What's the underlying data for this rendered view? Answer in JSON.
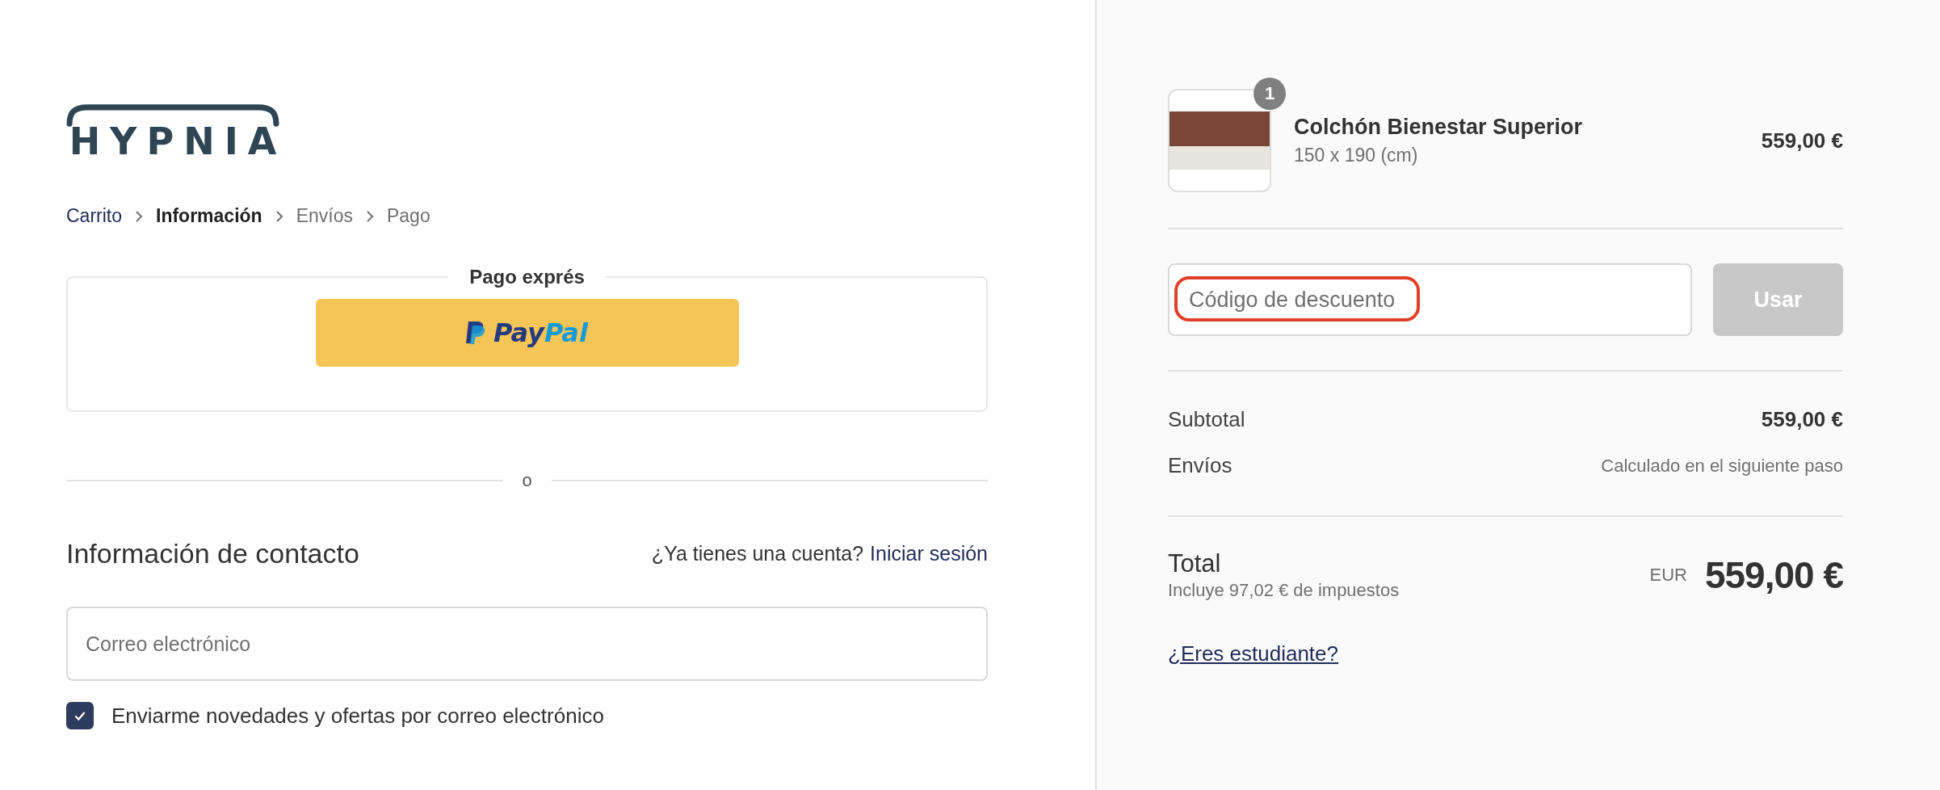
{
  "logo": {
    "text": "HYPNIA"
  },
  "breadcrumb": [
    {
      "label": "Carrito",
      "kind": "link"
    },
    {
      "label": "Información",
      "kind": "current"
    },
    {
      "label": "Envíos",
      "kind": "upcoming"
    },
    {
      "label": "Pago",
      "kind": "upcoming"
    }
  ],
  "express_checkout": {
    "title": "Pago exprés",
    "paypal_button": {
      "text_dark": "Pay",
      "text_light": "Pal"
    }
  },
  "separator": "o",
  "contact": {
    "title": "Información de contacto",
    "account_prompt": "¿Ya tienes una cuenta?",
    "login_link": "Iniciar sesión",
    "email_field": {
      "placeholder": "Correo electrónico"
    },
    "newsletter": {
      "label": "Enviarme novedades y ofertas por correo electrónico",
      "checked": true
    }
  },
  "order_summary": {
    "items": [
      {
        "name": "Colchón Bienestar Superior",
        "variant": "150 x 190 (cm)",
        "price": "559,00 €",
        "quantity": "1"
      }
    ],
    "discount": {
      "placeholder": "Código de descuento",
      "highlighted": true,
      "button": "Usar",
      "button_disabled": true
    },
    "lines": [
      {
        "label": "Subtotal",
        "value": "559,00 €",
        "kind": "amount"
      },
      {
        "label": "Envíos",
        "value": "Calculado en el siguiente paso",
        "kind": "note"
      }
    ],
    "total": {
      "label": "Total",
      "taxes": "Incluye 97,02 € de impuestos",
      "currency": "EUR",
      "amount": "559,00 €"
    },
    "student_link": "¿Eres estudiante?"
  }
}
